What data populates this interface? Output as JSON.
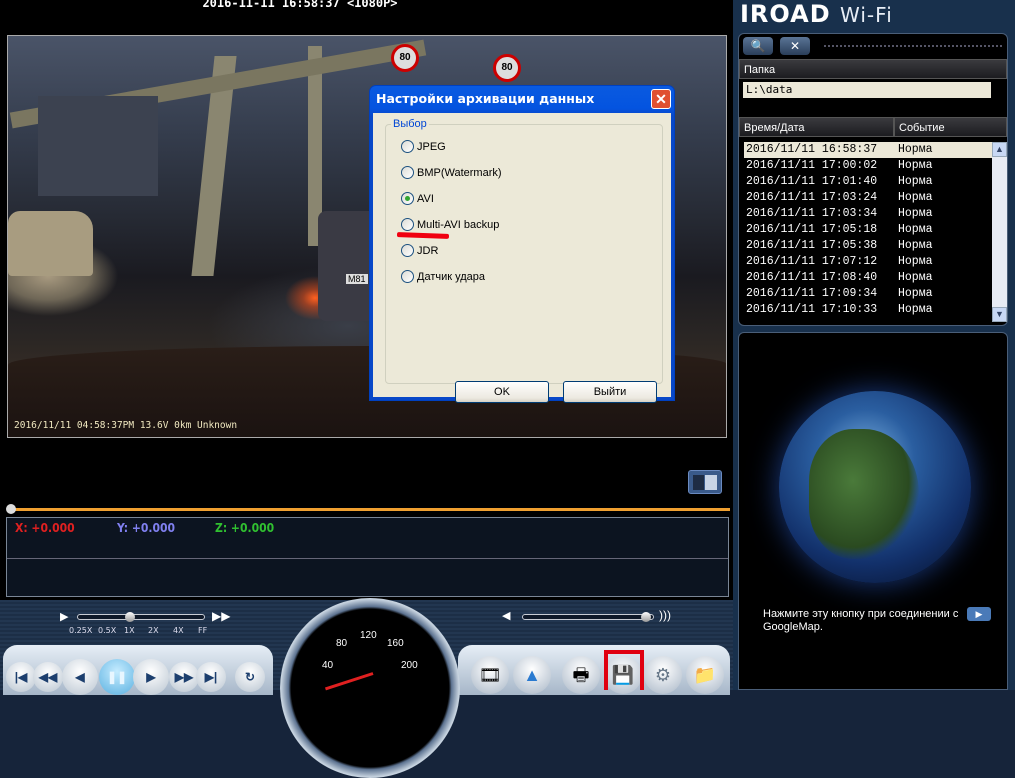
{
  "player": {
    "title": "2016-11-11 16:58:37 <1080P>",
    "osd": "2016/11/11 04:58:37PM 13.6V   0km Unknown",
    "sign_speed": "80",
    "plate": "M81",
    "progress": 0.0,
    "sensor": {
      "x_label": "X",
      "x_value": "+0.000",
      "y_label": "Y",
      "y_value": "+0.000",
      "z_label": "Z",
      "z_value": "+0.000",
      "x_color": "#e02020",
      "y_color": "#8080f0",
      "z_color": "#30c030"
    },
    "speed_labels": [
      "0.25X",
      "0.5X",
      "1X",
      "2X",
      "4X",
      "FF"
    ],
    "speed_value": "1X",
    "volume": 1.0,
    "gauge_ticks": [
      "40",
      "80",
      "120",
      "160",
      "200"
    ]
  },
  "sidebar": {
    "logo": "IROAD",
    "logo_suffix": "Wi-Fi",
    "folder_header": "Папка",
    "folder_value": "L:\\data",
    "col_time": "Время/Дата",
    "col_event": "Событие",
    "rows": [
      {
        "time": "2016/11/11 16:58:37",
        "event": "Норма"
      },
      {
        "time": "2016/11/11 17:00:02",
        "event": "Норма"
      },
      {
        "time": "2016/11/11 17:01:40",
        "event": "Норма"
      },
      {
        "time": "2016/11/11 17:03:24",
        "event": "Норма"
      },
      {
        "time": "2016/11/11 17:03:34",
        "event": "Норма"
      },
      {
        "time": "2016/11/11 17:05:18",
        "event": "Норма"
      },
      {
        "time": "2016/11/11 17:05:38",
        "event": "Норма"
      },
      {
        "time": "2016/11/11 17:07:12",
        "event": "Норма"
      },
      {
        "time": "2016/11/11 17:08:40",
        "event": "Норма"
      },
      {
        "time": "2016/11/11 17:09:34",
        "event": "Норма"
      },
      {
        "time": "2016/11/11 17:10:33",
        "event": "Норма"
      }
    ],
    "map_text": "Нажмите эту кнопку при соединении с GoogleMap."
  },
  "dialog": {
    "title": "Настройки архивации данных",
    "group": "Выбор",
    "options": [
      "JPEG",
      "BMP(Watermark)",
      "AVI",
      "Multi-AVI backup",
      "JDR",
      "Датчик удара"
    ],
    "selected": "AVI",
    "ok": "OK",
    "exit": "Выйти"
  }
}
